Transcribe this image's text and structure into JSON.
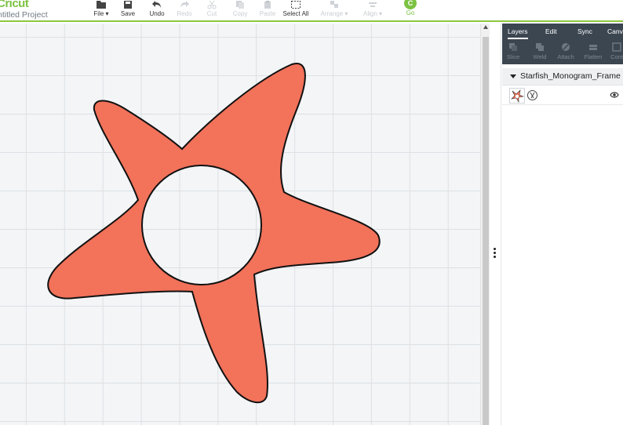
{
  "app": {
    "brand": "Cricut",
    "project_title": "ntitled Project"
  },
  "toolbar": {
    "items": [
      {
        "label": "File ▾",
        "icon": "folder-icon",
        "enabled": true
      },
      {
        "label": "Save",
        "icon": "save-icon",
        "enabled": true
      },
      {
        "label": "Undo",
        "icon": "undo-icon",
        "enabled": true
      },
      {
        "label": "Redo",
        "icon": "redo-icon",
        "enabled": false
      },
      {
        "label": "Cut",
        "icon": "cut-icon",
        "enabled": false
      },
      {
        "label": "Copy",
        "icon": "copy-icon",
        "enabled": false
      },
      {
        "label": "Paste",
        "icon": "paste-icon",
        "enabled": false
      },
      {
        "label": "Select All",
        "icon": "select-all-icon",
        "enabled": true
      },
      {
        "label": "Arrange ▾",
        "icon": "arrange-icon",
        "enabled": false
      },
      {
        "label": "Align ▾",
        "icon": "align-icon",
        "enabled": false
      }
    ],
    "go_letter": "C",
    "go_label": "Go"
  },
  "panel": {
    "tabs": [
      "Layers",
      "Edit",
      "Sync",
      "Canv"
    ],
    "active_tab": "Layers",
    "tools": [
      "Slice",
      "Weld",
      "Attach",
      "Flatten",
      "Cont"
    ],
    "group_name": "Starfish_Monogram_Frame"
  },
  "canvas": {
    "shape_name": "starfish",
    "fill_color": "#f2725a",
    "stroke_color": "#111111"
  },
  "colors": {
    "brand_green": "#7cc242",
    "panel_dark": "#3c4651"
  }
}
